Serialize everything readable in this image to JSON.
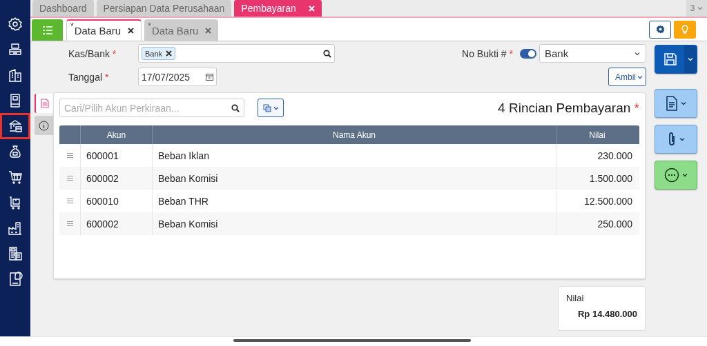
{
  "sidebar": {
    "items": [
      {
        "selected": false
      },
      {
        "selected": false
      },
      {
        "selected": false
      },
      {
        "selected": false
      },
      {
        "selected": true
      },
      {
        "selected": false
      },
      {
        "selected": false
      },
      {
        "selected": false
      },
      {
        "selected": false
      },
      {
        "selected": false
      },
      {
        "selected": false
      }
    ]
  },
  "top_tabs": [
    {
      "label": "Dashboard",
      "selected": false,
      "closable": false
    },
    {
      "label": "Persiapan Data Perusahaan",
      "selected": false,
      "closable": false
    },
    {
      "label": "Pembayaran",
      "selected": true,
      "closable": true
    }
  ],
  "tab_overflow": {
    "count": "3"
  },
  "doc_tabs": [
    {
      "marker": "*",
      "label": "Data Baru",
      "selected": true
    },
    {
      "marker": "*",
      "label": "Data Baru",
      "selected": false
    }
  ],
  "form": {
    "kas_bank": {
      "label": "Kas/Bank",
      "mark": "*",
      "chips": [
        "Bank"
      ]
    },
    "tanggal": {
      "label": "Tanggal",
      "mark": "*",
      "value": "17/07/2025"
    },
    "no_bukti": {
      "label": "No Bukti #",
      "mark": "*",
      "auto": true,
      "value": "Bank"
    },
    "ambil_button": "Ambil"
  },
  "detail": {
    "side_tabs": [
      {
        "selected": true
      },
      {
        "selected": false
      }
    ],
    "search": {
      "placeholder": "Cari/Pilih Akun Perkiraan..."
    },
    "title": "4 Rincian Pembayaran",
    "title_mark": "*",
    "table": {
      "columns": [
        "Akun",
        "Nama Akun",
        "Nilai"
      ],
      "rows": [
        [
          "600001",
          "Beban Iklan",
          "230.000"
        ],
        [
          "600002",
          "Beban Komisi",
          "1.500.000"
        ],
        [
          "600010",
          "Beban THR",
          "12.500.000"
        ],
        [
          "600002",
          "Beban Komisi",
          "250.000"
        ]
      ]
    }
  },
  "total": {
    "label": "Nilai",
    "value": "Rp 14.480.000"
  }
}
